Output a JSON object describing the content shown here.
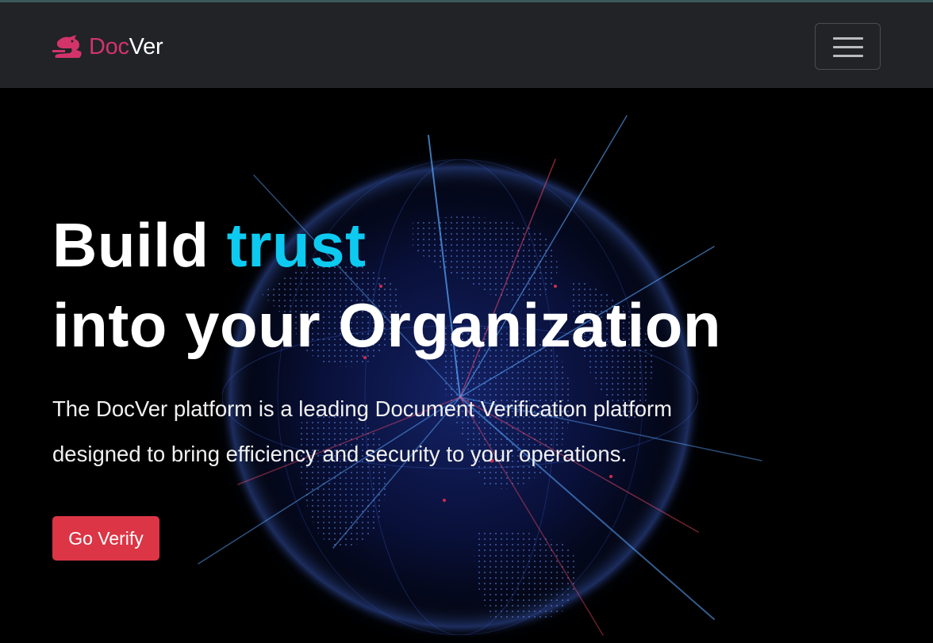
{
  "navbar": {
    "brand_part1": "Doc",
    "brand_part2": "Ver",
    "brand_color": "#d2346a",
    "background": "#212326",
    "toggler_icon": "hamburger-icon"
  },
  "hero": {
    "title_word1": "Build ",
    "title_accent": "trust",
    "title_line2": "into your Organization",
    "accent_color": "#0dcaf0",
    "lead_line1": "The DocVer platform is a leading Document Verification platform",
    "lead_line2": "designed to bring efficiency and security to your operations.",
    "cta_label": "Go Verify",
    "cta_color": "#dc3545",
    "background_image": "digital-globe-icon"
  }
}
